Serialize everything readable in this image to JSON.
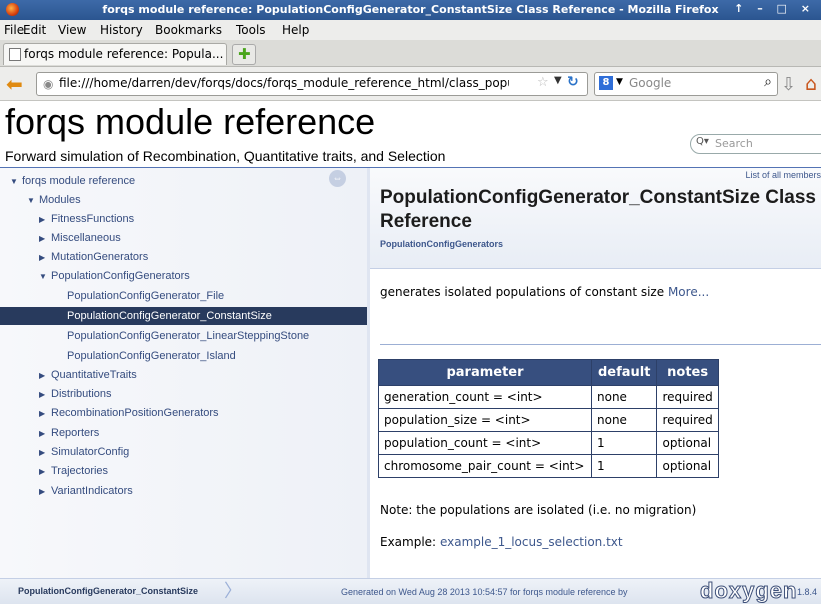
{
  "window": {
    "title": "forqs module reference: PopulationConfigGenerator_ConstantSize Class Reference - Mozilla Firefox",
    "controls": "↑ – □ ×"
  },
  "menu": [
    "File",
    "Edit",
    "View",
    "History",
    "Bookmarks",
    "Tools",
    "Help"
  ],
  "tab": {
    "title": "forqs module reference: Popula..."
  },
  "urlbar": {
    "url": "file:///home/darren/dev/forqs/docs/forqs_module_reference_html/class_populatior"
  },
  "searchbar": {
    "placeholder": "Google"
  },
  "header": {
    "project_name": "forqs module reference",
    "project_brief": "Forward simulation of Recombination, Quantitative traits, and Selection",
    "search_placeholder": "Search"
  },
  "sidenav": {
    "items": [
      {
        "label": "forqs module reference",
        "expanded": true
      },
      {
        "label": "Modules",
        "expanded": true
      },
      {
        "label": "FitnessFunctions",
        "expanded": false
      },
      {
        "label": "Miscellaneous",
        "expanded": false
      },
      {
        "label": "MutationGenerators",
        "expanded": false
      },
      {
        "label": "PopulationConfigGenerators",
        "expanded": true
      },
      {
        "label": "PopulationConfigGenerator_File"
      },
      {
        "label": "PopulationConfigGenerator_ConstantSize",
        "selected": true
      },
      {
        "label": "PopulationConfigGenerator_LinearSteppingStone"
      },
      {
        "label": "PopulationConfigGenerator_Island"
      },
      {
        "label": "QuantitativeTraits",
        "expanded": false
      },
      {
        "label": "Distributions",
        "expanded": false
      },
      {
        "label": "RecombinationPositionGenerators",
        "expanded": false
      },
      {
        "label": "Reporters",
        "expanded": false
      },
      {
        "label": "SimulatorConfig",
        "expanded": false
      },
      {
        "label": "Trajectories",
        "expanded": false
      },
      {
        "label": "VariantIndicators",
        "expanded": false
      }
    ]
  },
  "content": {
    "summary_link": "List of all members",
    "title": "PopulationConfigGenerator_ConstantSize Class Reference",
    "ingroup": "PopulationConfigGenerators",
    "brief": "generates isolated populations of constant size",
    "more": "More...",
    "table": {
      "headers": [
        "parameter",
        "default",
        "notes"
      ],
      "rows": [
        [
          "generation_count = <int>",
          "none",
          "required"
        ],
        [
          "population_size = <int>",
          "none",
          "required"
        ],
        [
          "population_count = <int>",
          "1",
          "optional"
        ],
        [
          "chromosome_pair_count = <int>",
          "1",
          "optional"
        ]
      ]
    },
    "note": "Note: the populations are isolated (i.e. no migration)",
    "example_label": "Example:",
    "example_link": "example_1_locus_selection.txt"
  },
  "footer": {
    "breadcrumb": "PopulationConfigGenerator_ConstantSize",
    "generated": "Generated on Wed Aug 28 2013 10:54:57 for forqs module reference by",
    "logo": "doxygen",
    "version": "1.8.4"
  }
}
